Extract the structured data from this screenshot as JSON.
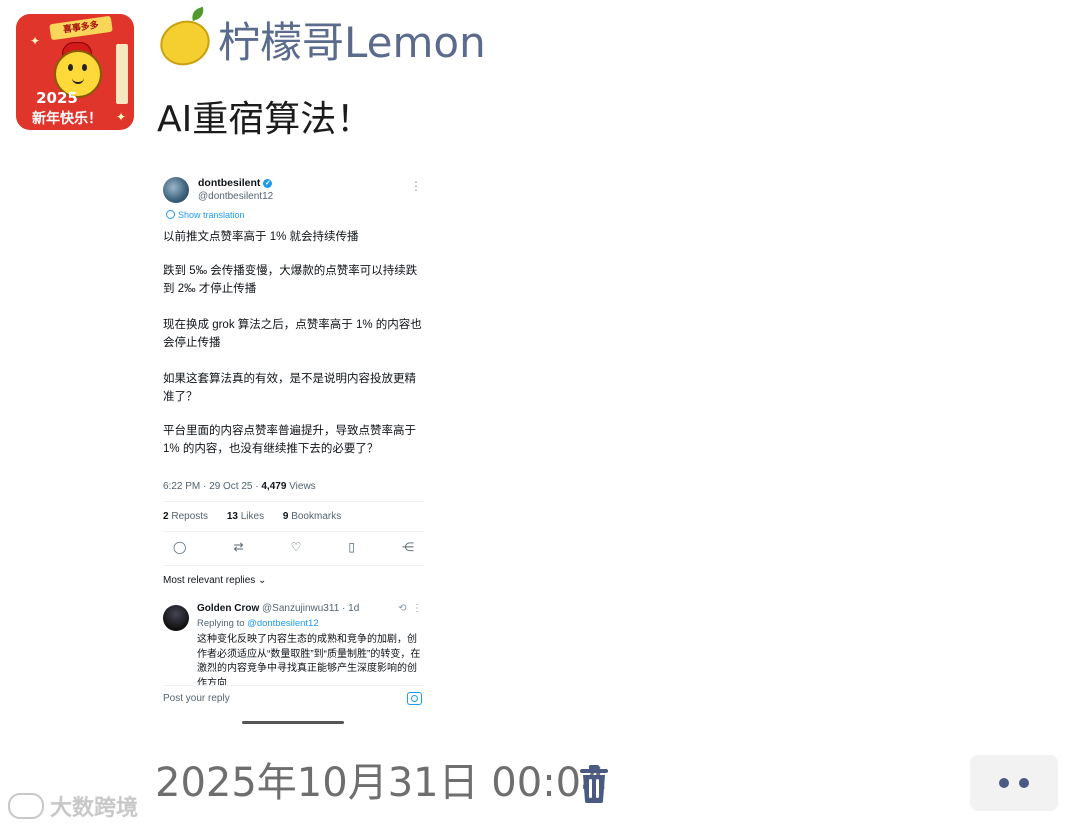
{
  "header": {
    "username": "柠檬哥Lemon",
    "post_text": "AI重宿算法！"
  },
  "avatar": {
    "banner": "喜事多多",
    "year": "2025",
    "greeting": "新年快乐！"
  },
  "tweet": {
    "name": "dontbesilent",
    "handle": "@dontbesilent12",
    "show_translation": "Show translation",
    "paragraphs": [
      "以前推文点赞率高于 1% 就会持续传播",
      "跌到 5‰ 会传播变慢，大爆款的点赞率可以持续跌到 2‰ 才停止传播",
      "现在换成 grok 算法之后，点赞率高于 1% 的内容也会停止传播",
      "如果这套算法真的有效，是不是说明内容投放更精准了？",
      "平台里面的内容点赞率普遍提升，导致点赞率高于 1% 的内容，也没有继续推下去的必要了？"
    ],
    "time": "6:22 PM · 29 Oct 25 · ",
    "views_count": "4,479",
    "views_label": " Views",
    "reposts_count": "2",
    "reposts_label": "Reposts",
    "likes_count": "13",
    "likes_label": "Likes",
    "bookmarks_count": "9",
    "bookmarks_label": "Bookmarks",
    "sort_label": "Most relevant replies ⌄",
    "reply": {
      "name": "Golden Crow",
      "handle_time": "@Sanzujinwu311 · 1d",
      "replying_prefix": "Replying to ",
      "replying_to": "@dontbesilent12",
      "text": "这种变化反映了内容生态的成熟和竞争的加剧，创作者必须适应从“数量取胜”到“质量制胜”的转变，在激烈的内容竞争中寻找真正能够产生深度影响的创作方向"
    },
    "reply_placeholder": "Post your reply"
  },
  "footer": {
    "timestamp": "2025年10月31日 00:04"
  },
  "watermark": "大数跨境",
  "colors": {
    "username": "#5b6b8e",
    "timestamp": "#6e6e6e",
    "twitter_blue": "#1d9bf0",
    "more_dots": "#4a5a82",
    "avatar_red": "#e0352b"
  }
}
